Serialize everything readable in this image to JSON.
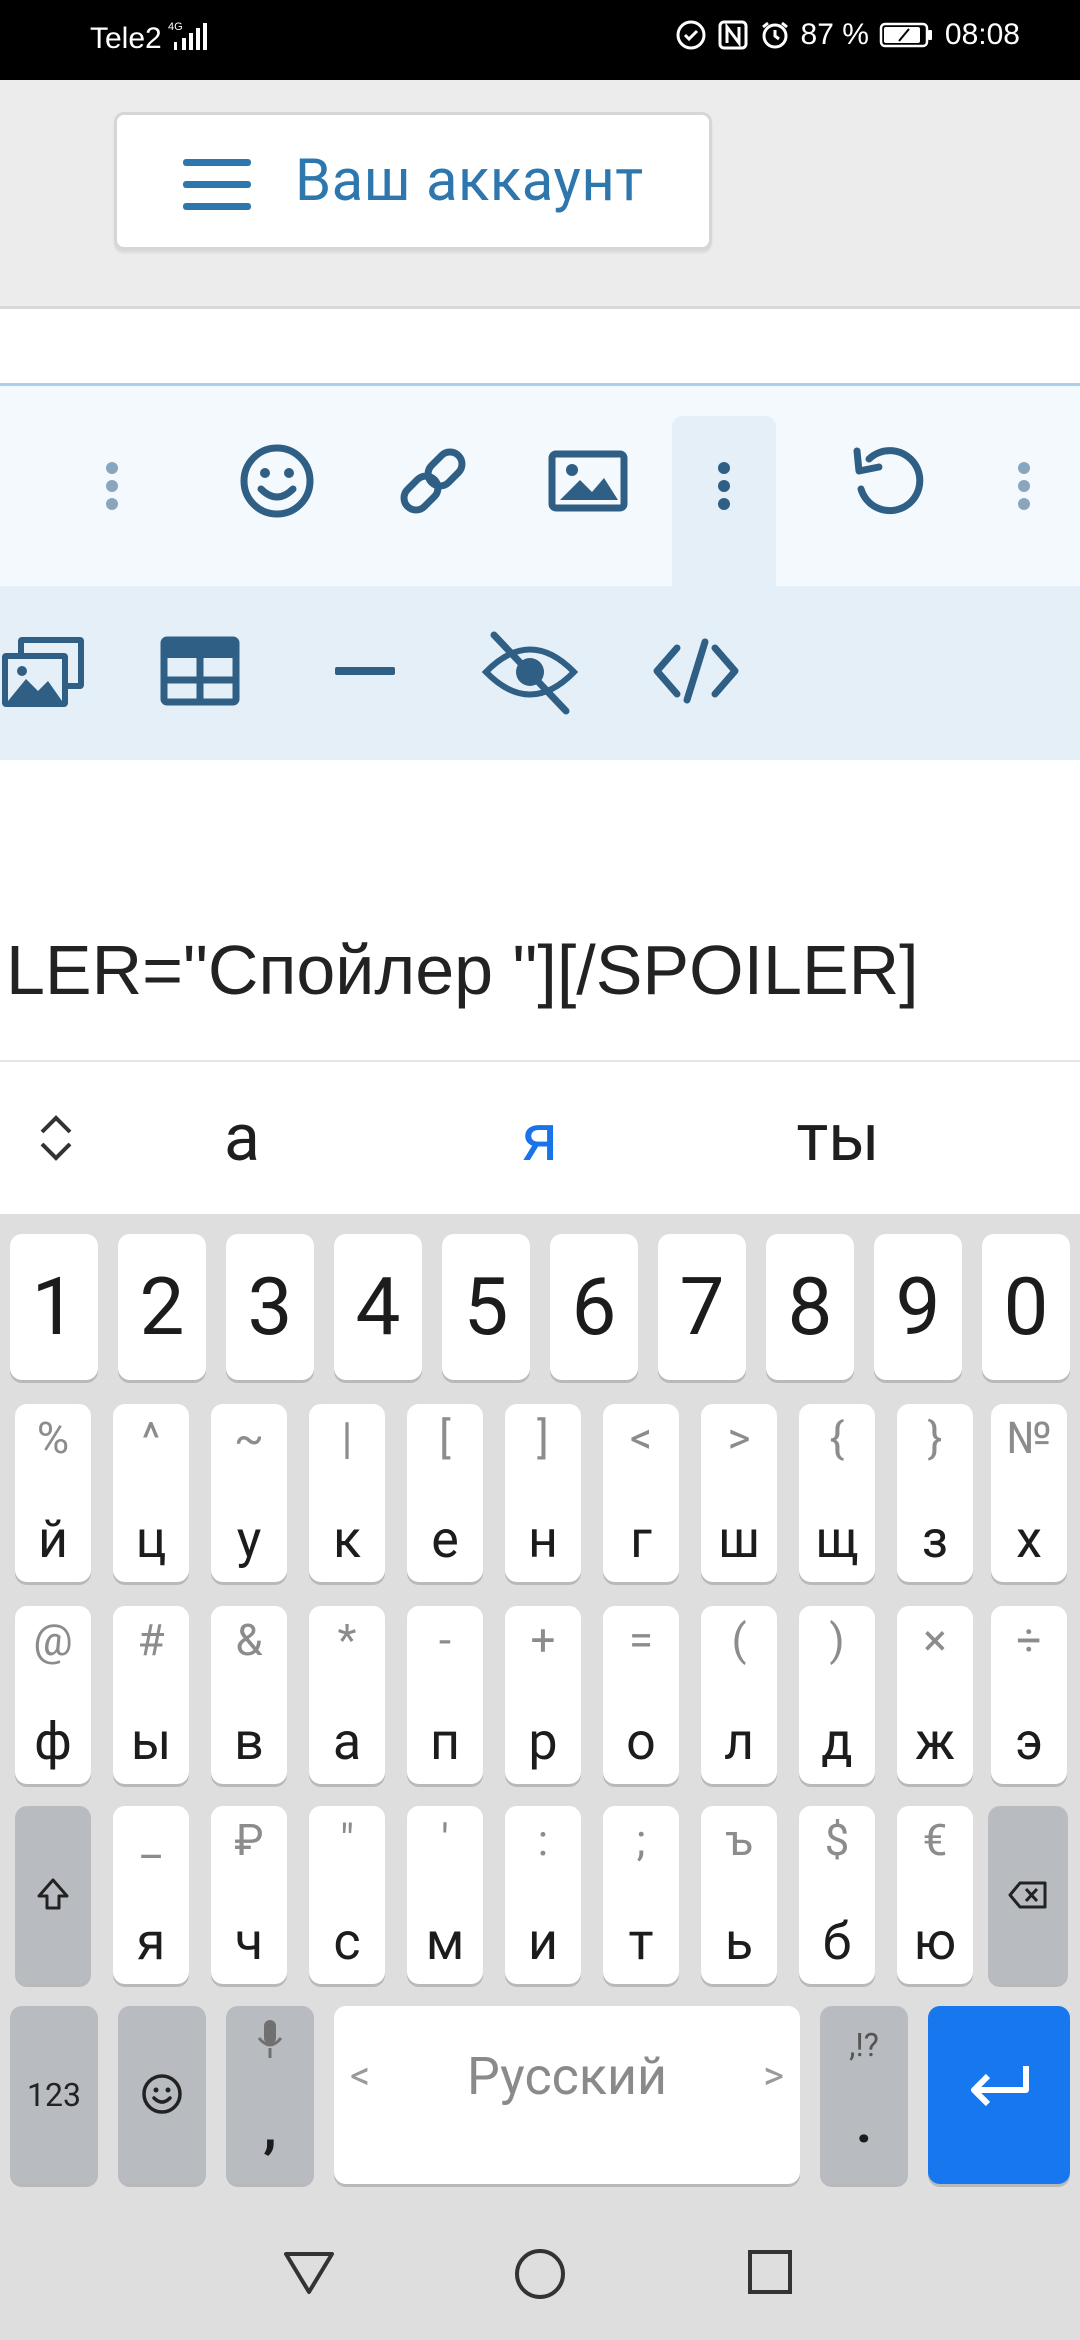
{
  "status_bar": {
    "carrier": "Tele2",
    "network": "4G",
    "battery_percent": "87 %",
    "time": "08:08"
  },
  "header": {
    "account_button_label": "Ваш аккаунт",
    "icons": [
      "menu-icon"
    ]
  },
  "toolbar": {
    "row1_icons": [
      "more-vertical-icon",
      "smiley-icon",
      "link-icon",
      "image-icon",
      "more-vertical-icon",
      "undo-icon",
      "more-vertical-icon"
    ],
    "row2_icons": [
      "gallery-icon",
      "table-icon",
      "horizontal-rule-icon",
      "spoiler-hidden-icon",
      "code-icon"
    ],
    "accent_color": "#2f5f84"
  },
  "editor": {
    "visible_text": "LER=\"Спойлер \"][/SPOILER]"
  },
  "suggestions": {
    "items": [
      "а",
      "я",
      "ты"
    ],
    "highlight_color": "#1a73e8"
  },
  "keyboard": {
    "number_row": [
      "1",
      "2",
      "3",
      "4",
      "5",
      "6",
      "7",
      "8",
      "9",
      "0"
    ],
    "row1": [
      {
        "top": "%",
        "main": "й"
      },
      {
        "top": "^",
        "main": "ц"
      },
      {
        "top": "~",
        "main": "у"
      },
      {
        "top": "|",
        "main": "к"
      },
      {
        "top": "[",
        "main": "е"
      },
      {
        "top": "]",
        "main": "н"
      },
      {
        "top": "<",
        "main": "г"
      },
      {
        "top": ">",
        "main": "ш"
      },
      {
        "top": "{",
        "main": "щ"
      },
      {
        "top": "}",
        "main": "з"
      },
      {
        "top": "№",
        "main": "х"
      }
    ],
    "row2": [
      {
        "top": "@",
        "main": "ф"
      },
      {
        "top": "#",
        "main": "ы"
      },
      {
        "top": "&",
        "main": "в"
      },
      {
        "top": "*",
        "main": "а"
      },
      {
        "top": "-",
        "main": "п"
      },
      {
        "top": "+",
        "main": "р"
      },
      {
        "top": "=",
        "main": "о"
      },
      {
        "top": "(",
        "main": "л"
      },
      {
        "top": ")",
        "main": "д"
      },
      {
        "top": "×",
        "main": "ж"
      },
      {
        "top": "÷",
        "main": "э"
      }
    ],
    "row3": [
      {
        "top": "_",
        "main": "я"
      },
      {
        "top": "₽",
        "main": "ч"
      },
      {
        "top": "\"",
        "main": "с"
      },
      {
        "top": "'",
        "main": "м"
      },
      {
        "top": ":",
        "main": "и"
      },
      {
        "top": ";",
        "main": "т"
      },
      {
        "top": "ъ",
        "main": "ь"
      },
      {
        "top": "$",
        "main": "б"
      },
      {
        "top": "€",
        "main": "ю"
      }
    ],
    "bottom": {
      "symbols_label": "123",
      "comma_label": ",",
      "space_label": "Русский",
      "space_left_arrow": "<",
      "space_right_arrow": ">",
      "period_top": ",!?",
      "period_label": ".",
      "enter_color": "#1677ee"
    }
  },
  "nav_bar": {
    "icons": [
      "back-triangle-icon",
      "home-circle-icon",
      "recents-square-icon"
    ]
  }
}
